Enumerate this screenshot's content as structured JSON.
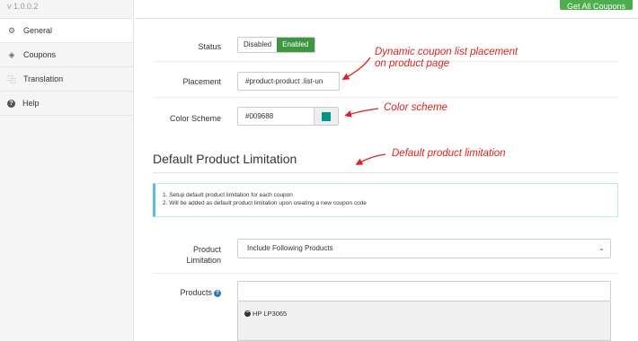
{
  "sidebar": {
    "version": "v 1.0.0.2",
    "items": [
      {
        "label": "General",
        "icon": "gear-icon"
      },
      {
        "label": "Coupons",
        "icon": "tag-icon"
      },
      {
        "label": "Translation",
        "icon": "translate-icon"
      },
      {
        "label": "Help",
        "icon": "question-icon"
      }
    ]
  },
  "topbar": {
    "button_label": "Get All Coupons"
  },
  "form": {
    "status_label": "Status",
    "status_off": "Disabled",
    "status_on": "Enabled",
    "placement_label": "Placement",
    "placement_value": "#product-product .list-un",
    "color_label": "Color Scheme",
    "color_value": "#009688",
    "color_swatch": "#009688"
  },
  "section": {
    "title": "Default Product Limitation",
    "notice_lines": [
      "1. Setup default product limitation for each coupon",
      "2. Will be added as default product limitation upon creating a new coupon code"
    ],
    "product_limitation_label_1": "Product",
    "product_limitation_label_2": "Limitation",
    "product_limitation_value": "Include Following Products",
    "products_label": "Products",
    "products": [
      "HP LP3065"
    ]
  },
  "annotations": {
    "placement_1": "Dynamic coupon list placement",
    "placement_2": "on product page",
    "color": "Color scheme",
    "limitation": "Default product limitation"
  },
  "colors": {
    "enabled": "#3d9740",
    "annotation": "#e02020",
    "accent": "#009688"
  }
}
